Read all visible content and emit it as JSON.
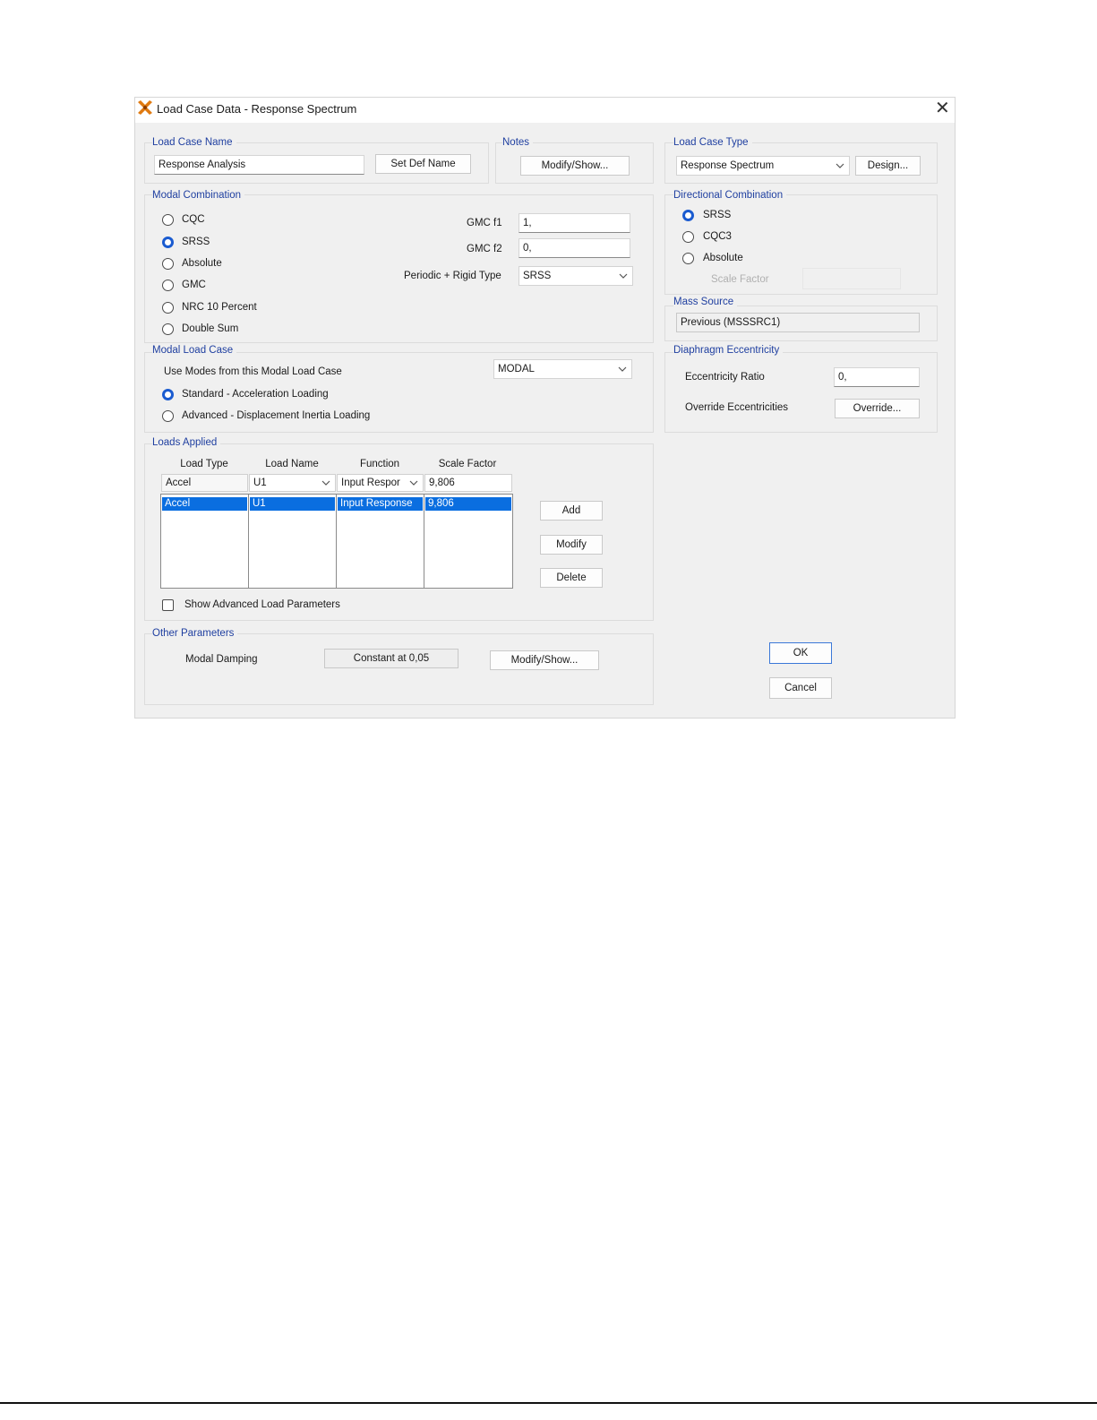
{
  "window": {
    "title": "Load Case Data - Response Spectrum",
    "close_glyph": "✕"
  },
  "load_case_name": {
    "label": "Load Case Name",
    "value": "Response Analysis",
    "set_def_name_button": "Set Def Name"
  },
  "notes": {
    "label": "Notes",
    "button": "Modify/Show..."
  },
  "load_case_type": {
    "label": "Load Case Type",
    "value": "Response Spectrum",
    "design_button": "Design..."
  },
  "modal_combination": {
    "label": "Modal Combination",
    "options": [
      "CQC",
      "SRSS",
      "Absolute",
      "GMC",
      "NRC 10 Percent",
      "Double Sum"
    ],
    "selected": "SRSS",
    "gmc_f1_label": "GMC  f1",
    "gmc_f1_value": "1,",
    "gmc_f2_label": "GMC  f2",
    "gmc_f2_value": "0,",
    "periodic_label": "Periodic + Rigid Type",
    "periodic_value": "SRSS"
  },
  "directional_combination": {
    "label": "Directional Combination",
    "options": [
      "SRSS",
      "CQC3",
      "Absolute"
    ],
    "selected": "SRSS",
    "scale_factor_label": "Scale Factor"
  },
  "mass_source": {
    "label": "Mass Source",
    "value": "Previous  (MSSSRC1)"
  },
  "modal_load_case": {
    "label": "Modal Load Case",
    "use_modes_label": "Use Modes from this Modal Load Case",
    "modal_value": "MODAL",
    "options": [
      "Standard - Acceleration Loading",
      "Advanced - Displacement Inertia Loading"
    ],
    "selected": "Standard - Acceleration Loading"
  },
  "diaphragm_eccentricity": {
    "label": "Diaphragm Eccentricity",
    "ratio_label": "Eccentricity Ratio",
    "ratio_value": "0,",
    "override_label": "Override Eccentricities",
    "override_button": "Override..."
  },
  "loads_applied": {
    "label": "Loads Applied",
    "columns": [
      "Load Type",
      "Load Name",
      "Function",
      "Scale Factor"
    ],
    "edit_row": {
      "load_type": "Accel",
      "load_name": "U1",
      "function": "Input Respor",
      "scale_factor": "9,806"
    },
    "rows": [
      {
        "load_type": "Accel",
        "load_name": "U1",
        "function": "Input Response",
        "scale_factor": "9,806"
      }
    ],
    "add_button": "Add",
    "modify_button": "Modify",
    "delete_button": "Delete",
    "show_advanced_label": "Show Advanced Load Parameters"
  },
  "other_parameters": {
    "label": "Other Parameters",
    "modal_damping_label": "Modal Damping",
    "modal_damping_value": "Constant at 0,05",
    "button": "Modify/Show..."
  },
  "actions": {
    "ok": "OK",
    "cancel": "Cancel"
  },
  "colors": {
    "group_label": "#1f3fa0",
    "selection": "#0a6ee0",
    "dialog_bg": "#f0f0f0",
    "icon_orange": "#e07a10"
  }
}
